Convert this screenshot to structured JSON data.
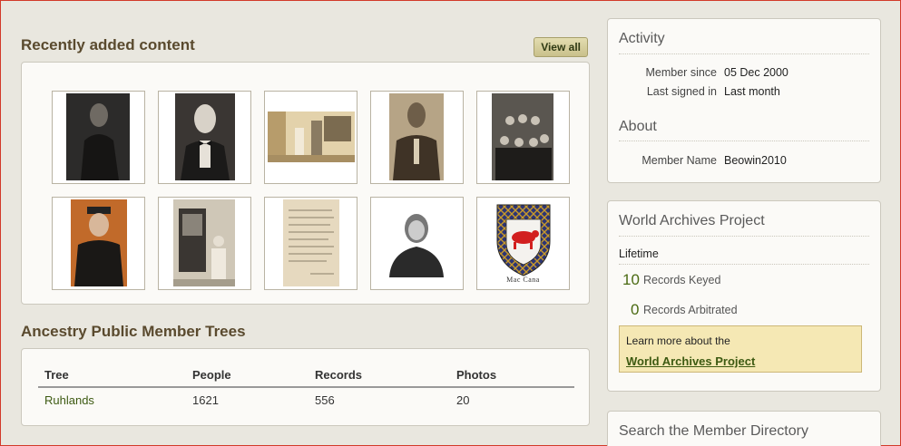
{
  "recent": {
    "title": "Recently added content",
    "view_all": "View all",
    "thumbs": [
      {
        "label": "portrait-woman-seated"
      },
      {
        "label": "portrait-man-bowtie"
      },
      {
        "label": "house-porch-people"
      },
      {
        "label": "portrait-man-tie"
      },
      {
        "label": "family-group"
      },
      {
        "label": "portrait-man-cap"
      },
      {
        "label": "man-at-door"
      },
      {
        "label": "handwritten-letter"
      },
      {
        "label": "portrait-elderly-woman"
      },
      {
        "label": "coat-of-arms",
        "caption": "Mac Cana"
      }
    ]
  },
  "trees": {
    "title": "Ancestry Public Member Trees",
    "columns": [
      "Tree",
      "People",
      "Records",
      "Photos"
    ],
    "rows": [
      [
        "Ruhlands",
        "1621",
        "556",
        "20"
      ]
    ]
  },
  "activity": {
    "title": "Activity",
    "member_since_label": "Member since",
    "member_since": "05 Dec 2000",
    "last_signed_label": "Last signed in",
    "last_signed": "Last month"
  },
  "about": {
    "title": "About",
    "member_name_label": "Member Name",
    "member_name": "Beowin2010"
  },
  "wap": {
    "title": "World Archives Project",
    "lifetime": "Lifetime",
    "keyed_count": "10",
    "keyed_label": "Records Keyed",
    "arbitrated_count": "0",
    "arbitrated_label": "Records Arbitrated",
    "learn_text": "Learn more about the",
    "learn_link": "World Archives Project"
  },
  "search": {
    "title": "Search the Member Directory"
  },
  "colors": {
    "link": "#3d5a12",
    "heading": "#5a4a2e",
    "highlight_box": "#f5e8b4"
  }
}
